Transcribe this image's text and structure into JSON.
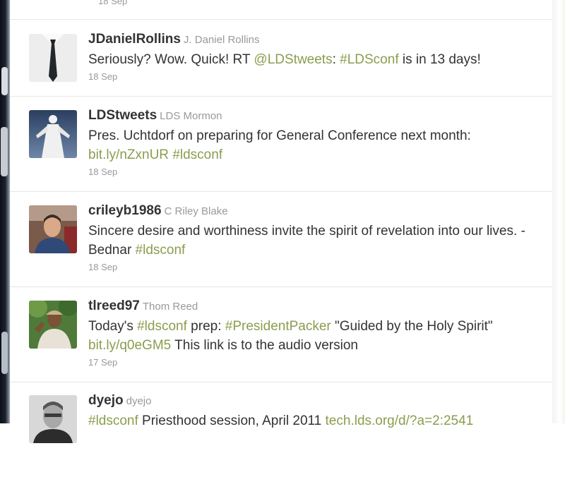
{
  "previous_tweet": {
    "date": "18 Sep"
  },
  "tweets": [
    {
      "screen_name": "JDanielRollins",
      "full_name": "J. Daniel Rollins",
      "date": "18 Sep",
      "avatar_icon": "tie-avatar-icon",
      "text": {
        "t1": "Seriously? Wow. Quick! RT ",
        "t2": "@LDStweets",
        "t3": ": ",
        "t4": "#LDSconf",
        "t5": " is in 13 days!"
      }
    },
    {
      "screen_name": "LDStweets",
      "full_name": "LDS Mormon",
      "date": "18 Sep",
      "avatar_icon": "statue-avatar-icon",
      "text": {
        "t1": "Pres. Uchtdorf on preparing for General Conference next month: ",
        "t2": "bit.ly/nZxnUR",
        "t3": " ",
        "t4": "#ldsconf"
      }
    },
    {
      "screen_name": "crileyb1986",
      "full_name": "C Riley Blake",
      "date": "18 Sep",
      "avatar_icon": "person-avatar-icon",
      "text": {
        "t1": "Sincere desire and worthiness invite the spirit of revelation into our lives. - Bednar ",
        "t2": "#ldsconf"
      }
    },
    {
      "screen_name": "tlreed97",
      "full_name": "Thom Reed",
      "date": "17 Sep",
      "avatar_icon": "outdoor-avatar-icon",
      "text": {
        "t1": "Today's ",
        "t2": "#ldsconf",
        "t3": " prep: ",
        "t4": "#PresidentPacker",
        "t5": " \"Guided by the Holy Spirit\" ",
        "t6": "bit.ly/q0eGM5",
        "t7": " This link is to the audio version"
      }
    },
    {
      "screen_name": "dyejo",
      "full_name": "dyejo",
      "date": "",
      "avatar_icon": "portrait-avatar-icon",
      "text": {
        "t1": "#ldsconf",
        "t2": " Priesthood session, April 2011 ",
        "t3": "tech.lds.org/d/?a=2:2541"
      }
    }
  ],
  "colors": {
    "link": "#8a9d4e",
    "screen_name": "#333333",
    "meta": "#999999"
  }
}
